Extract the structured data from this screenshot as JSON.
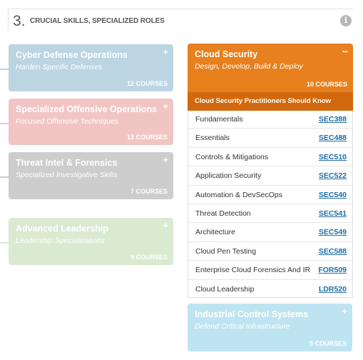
{
  "section": {
    "number": "3.",
    "title": "CRUCIAL SKILLS, SPECIALIZED ROLES",
    "info_glyph": "i"
  },
  "cards": [
    {
      "title": "Cyber Defense Operations",
      "subtitle": "Harden Specific Defenses",
      "count": "12 COURSES",
      "toggle": "+",
      "color": "#bcd5e3"
    },
    {
      "title": "Specialized Offensive Operations",
      "subtitle": "Focused Offensive Techniques",
      "count": "13 COURSES",
      "toggle": "+",
      "color": "#f2c5c5"
    },
    {
      "title": "Threat Intel & Forensics",
      "subtitle": "Specialized Investigative Skills",
      "count": "7 COURSES",
      "toggle": "+",
      "color": "#cdcdcd"
    },
    {
      "title": "Advanced Leadership",
      "subtitle": "Leadership Specializations",
      "count": "9 COURSES",
      "toggle": "+",
      "color": "#d9ead0"
    }
  ],
  "active": {
    "title": "Cloud Security",
    "subtitle": "Design, Develop, Build & Deploy",
    "count": "10 COURSES",
    "toggle": "−",
    "subheader": "Cloud Security Practitioners Should Know",
    "color": "#e8801e",
    "courses": [
      {
        "name": "Fundamentals",
        "code": "SEC388"
      },
      {
        "name": "Essentials",
        "code": "SEC488"
      },
      {
        "name": "Controls & Mitigations",
        "code": "SEC510"
      },
      {
        "name": "Application Security",
        "code": "SEC522"
      },
      {
        "name": "Automation & DevSecOps",
        "code": "SEC540"
      },
      {
        "name": "Threat Detection",
        "code": "SEC541"
      },
      {
        "name": "Architecture",
        "code": "SEC549"
      },
      {
        "name": "Cloud Pen Testing",
        "code": "SEC588"
      },
      {
        "name": "Enterprise Cloud Forensics And IR",
        "code": "FOR509"
      },
      {
        "name": "Cloud Leadership",
        "code": "LDR520"
      }
    ]
  },
  "bottom_card": {
    "title": "Industrial Control Systems",
    "subtitle": "Defend Critical Infrastructure",
    "count": "5 COURSES",
    "toggle": "+",
    "color": "#bfe4f1"
  }
}
